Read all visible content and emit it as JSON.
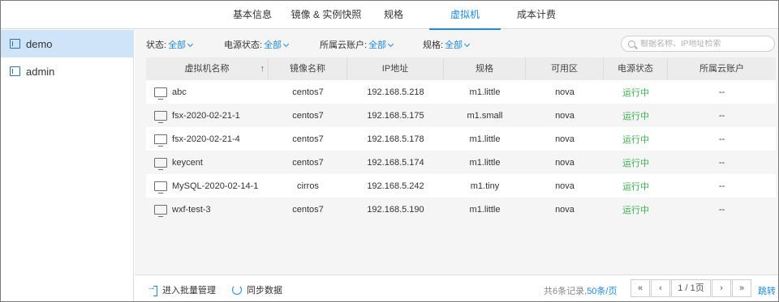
{
  "tabs": [
    {
      "label": "基本信息",
      "active": false
    },
    {
      "label": "镜像 & 实例快照",
      "active": false
    },
    {
      "label": "规格",
      "active": false
    },
    {
      "label": "虚拟机",
      "active": true
    },
    {
      "label": "成本计费",
      "active": false
    }
  ],
  "sidebar": {
    "items": [
      {
        "label": "demo",
        "active": true
      },
      {
        "label": "admin",
        "active": false
      }
    ]
  },
  "filters": {
    "status_label": "状态:",
    "status_value": "全部",
    "power_label": "电源状态:",
    "power_value": "全部",
    "account_label": "所属云账户:",
    "account_value": "全部",
    "spec_label": "规格:",
    "spec_value": "全部"
  },
  "search": {
    "placeholder": "根据名称、IP地址检索"
  },
  "table": {
    "headers": [
      "虚拟机名称",
      "镜像名称",
      "IP地址",
      "规格",
      "可用区",
      "电源状态",
      "所属云账户"
    ],
    "sort_indicator": "↑",
    "rows": [
      {
        "name": "abc",
        "image": "centos7",
        "ip": "192.168.5.218",
        "spec": "m1.little",
        "zone": "nova",
        "power": "运行中",
        "account": "--"
      },
      {
        "name": "fsx-2020-02-21-1",
        "image": "centos7",
        "ip": "192.168.5.175",
        "spec": "m1.small",
        "zone": "nova",
        "power": "运行中",
        "account": "--"
      },
      {
        "name": "fsx-2020-02-21-4",
        "image": "centos7",
        "ip": "192.168.5.178",
        "spec": "m1.little",
        "zone": "nova",
        "power": "运行中",
        "account": "--"
      },
      {
        "name": "keycent",
        "image": "centos7",
        "ip": "192.168.5.174",
        "spec": "m1.little",
        "zone": "nova",
        "power": "运行中",
        "account": "--"
      },
      {
        "name": "MySQL-2020-02-14-1",
        "image": "cirros",
        "ip": "192.168.5.242",
        "spec": "m1.tiny",
        "zone": "nova",
        "power": "运行中",
        "account": "--"
      },
      {
        "name": "wxf-test-3",
        "image": "centos7",
        "ip": "192.168.5.190",
        "spec": "m1.little",
        "zone": "nova",
        "power": "运行中",
        "account": "--"
      }
    ]
  },
  "footer": {
    "batch_label": "进入批量管理",
    "sync_label": "同步数据",
    "records_text": "共6条记录,",
    "per_page": "50条/页",
    "first": "«",
    "prev": "‹",
    "page": "1 / 1页",
    "next": "›",
    "last": "»",
    "jump": "跳转"
  },
  "colors": {
    "accent": "#1e88e5",
    "running": "#3bb04f",
    "sidebar_active": "#cfe4f8"
  }
}
